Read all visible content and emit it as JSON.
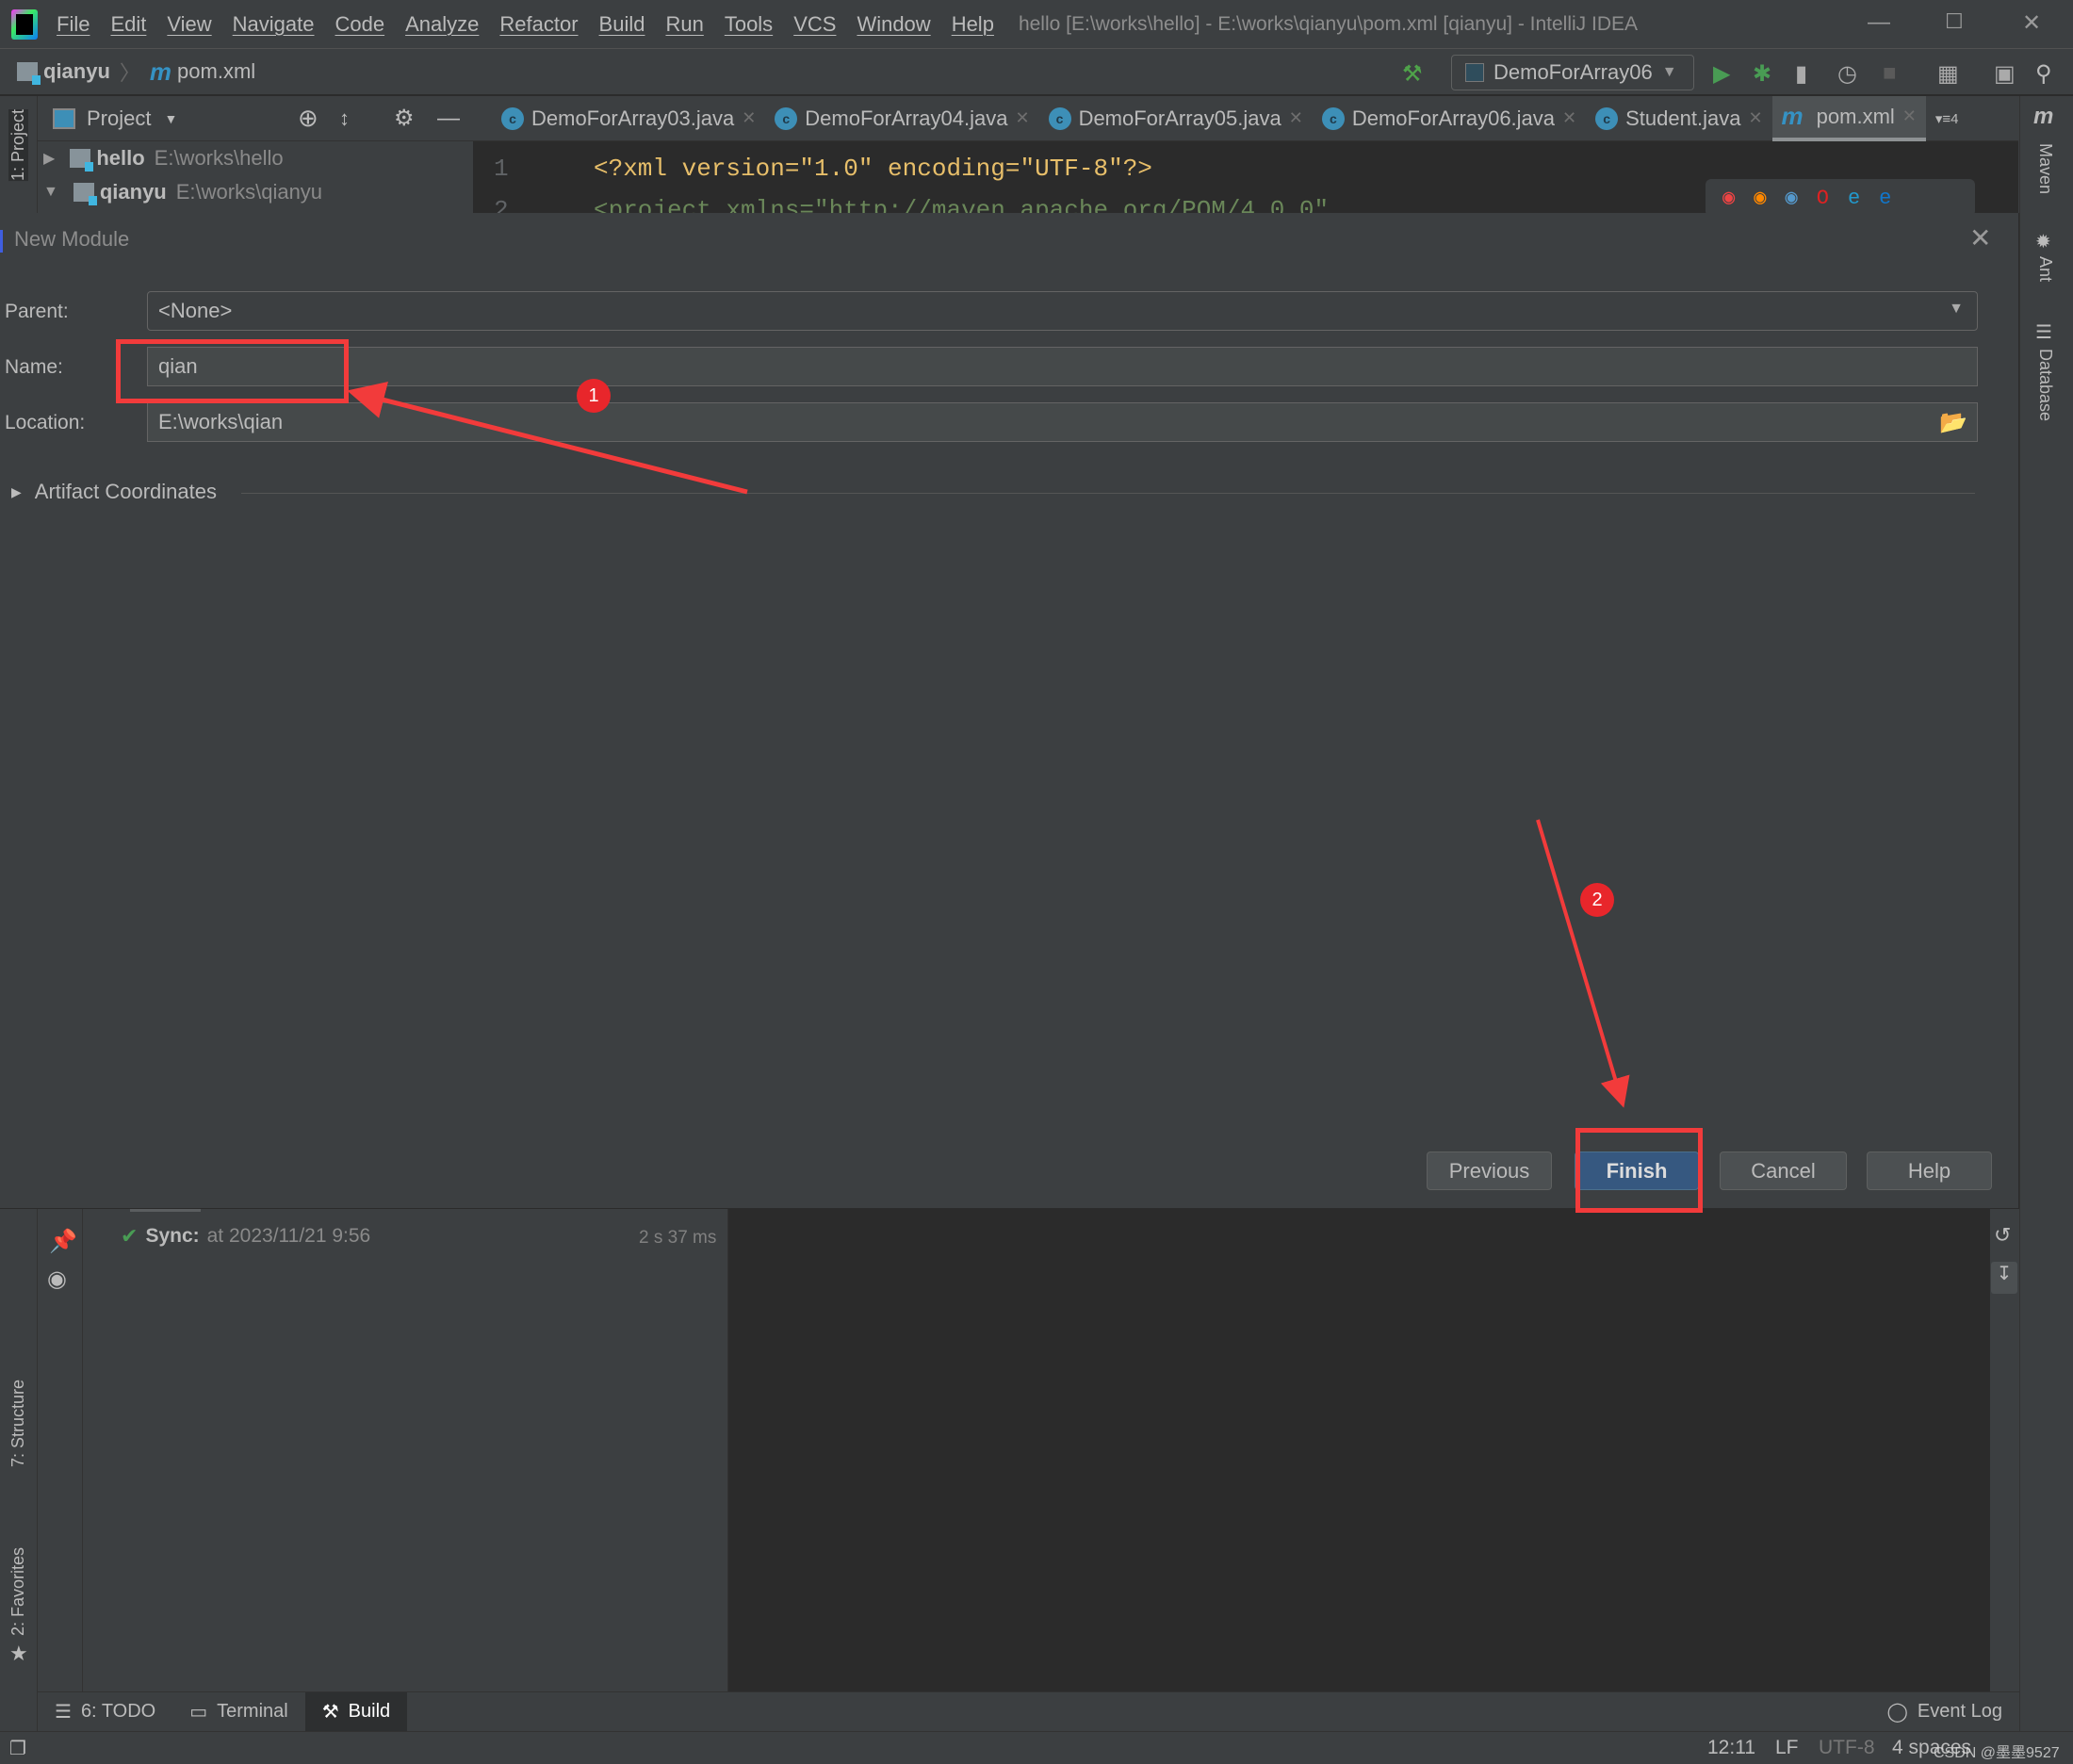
{
  "menubar": {
    "items": [
      "File",
      "Edit",
      "View",
      "Navigate",
      "Code",
      "Analyze",
      "Refactor",
      "Build",
      "Run",
      "Tools",
      "VCS",
      "Window",
      "Help"
    ],
    "window_title": "hello [E:\\works\\hello] - E:\\works\\qianyu\\pom.xml [qianyu] - IntelliJ IDEA"
  },
  "navbar": {
    "project": "qianyu",
    "file": "pom.xml",
    "run_config": "DemoForArray06"
  },
  "project_panel": {
    "title": "Project",
    "rows": [
      {
        "name": "hello",
        "path": "E:\\works\\hello"
      },
      {
        "name": "qianyu",
        "path": "E:\\works\\qianyu"
      }
    ]
  },
  "tabs": [
    {
      "label": "DemoForArray03.java"
    },
    {
      "label": "DemoForArray04.java"
    },
    {
      "label": "DemoForArray05.java"
    },
    {
      "label": "DemoForArray06.java"
    },
    {
      "label": "Student.java"
    },
    {
      "label": "pom.xml",
      "active": true
    }
  ],
  "tabs_overflow": "4",
  "editor": {
    "line1_no": "1",
    "line1": "<?xml version=\"1.0\" encoding=\"UTF-8\"?>",
    "line2_no": "2",
    "line2": "<project xmlns=\"http://maven.apache.org/POM/4.0.0\""
  },
  "left_stripe": {
    "project": "1: Project",
    "structure": "7: Structure",
    "favorites": "2: Favorites"
  },
  "right_stripe": {
    "maven": "Maven",
    "ant": "Ant",
    "database": "Database"
  },
  "dialog": {
    "title": "New Module",
    "parent_label": "Parent:",
    "parent_value": "<None>",
    "name_label": "Name:",
    "name_value": "qian",
    "location_label": "Location:",
    "location_value": "E:\\works\\qian",
    "artifact_section": "Artifact Coordinates",
    "buttons": {
      "previous": "Previous",
      "finish": "Finish",
      "cancel": "Cancel",
      "help": "Help"
    }
  },
  "annotations": {
    "step1": "1",
    "step2": "2",
    "color": "#f23b3b"
  },
  "build": {
    "sync_label": "Sync:",
    "sync_time": "at 2023/11/21 9:56",
    "duration": "2 s 37 ms"
  },
  "tool_tabs": {
    "todo": "6: TODO",
    "terminal": "Terminal",
    "build": "Build",
    "event_log": "Event Log"
  },
  "statusbar": {
    "position": "12:11",
    "line_sep": "LF",
    "encoding": "UTF-8",
    "indent": "4 spaces",
    "watermark": "CSDN @墨墨9527"
  }
}
